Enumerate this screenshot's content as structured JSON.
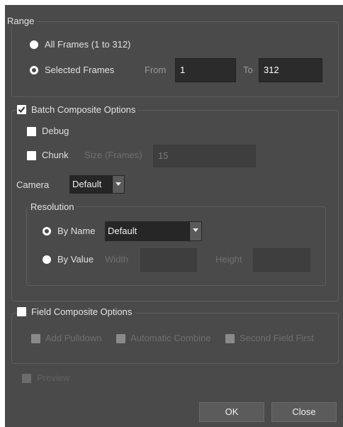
{
  "range": {
    "title": "Range",
    "all_frames_label": "All Frames (1 to 312)",
    "selected_frames_label": "Selected Frames",
    "from_label": "From",
    "from_value": "1",
    "to_label": "To",
    "to_value": "312"
  },
  "batch": {
    "title": "Batch Composite Options",
    "debug_label": "Debug",
    "chunk_label": "Chunk",
    "size_label": "Size (Frames)",
    "size_value": "15",
    "camera_label": "Camera",
    "camera_value": "Default",
    "resolution": {
      "title": "Resolution",
      "by_name_label": "By Name",
      "by_name_value": "Default",
      "by_value_label": "By Value",
      "width_label": "Width",
      "height_label": "Height"
    }
  },
  "field": {
    "title": "Field Composite Options",
    "add_pulldown_label": "Add Pulldown",
    "automatic_combine_label": "Automatic Combine",
    "second_field_first_label": "Second Field First"
  },
  "preview_label": "Preview",
  "buttons": {
    "ok": "OK",
    "close": "Close"
  }
}
